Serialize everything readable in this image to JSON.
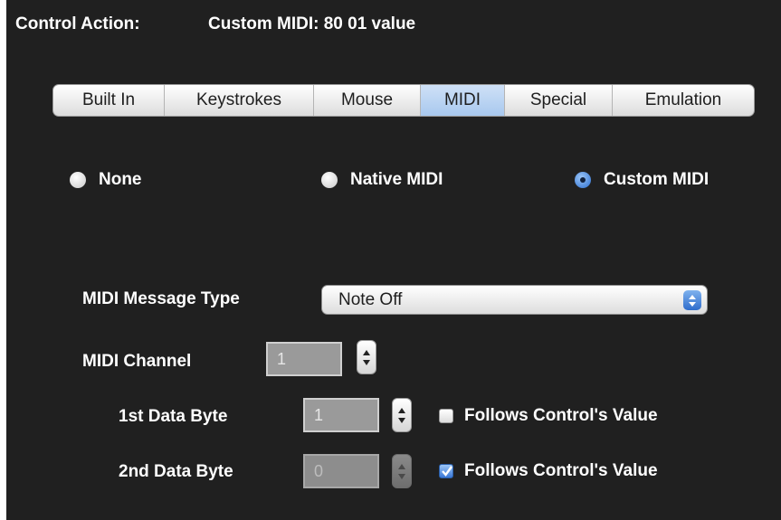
{
  "header": {
    "label": "Control Action:",
    "value": "Custom MIDI: 80 01  value"
  },
  "tabs": [
    {
      "label": "Built In",
      "selected": false
    },
    {
      "label": "Keystrokes",
      "selected": false
    },
    {
      "label": "Mouse",
      "selected": false
    },
    {
      "label": "MIDI",
      "selected": true
    },
    {
      "label": "Special",
      "selected": false
    },
    {
      "label": "Emulation",
      "selected": false
    }
  ],
  "mode": {
    "none_label": "None",
    "native_label": "Native MIDI",
    "custom_label": "Custom MIDI",
    "selected": "custom"
  },
  "message_type": {
    "label": "MIDI Message Type",
    "value": "Note Off"
  },
  "channel": {
    "label": "MIDI Channel",
    "value": "1"
  },
  "data_byte_1": {
    "label": "1st Data Byte",
    "value": "1",
    "follows_label": "Follows Control's Value",
    "follows_checked": false
  },
  "data_byte_2": {
    "label": "2nd Data Byte",
    "value": "0",
    "follows_label": "Follows Control's Value",
    "follows_checked": true
  },
  "colors": {
    "panel_bg": "#202020",
    "accent": "#2f6dcc"
  }
}
